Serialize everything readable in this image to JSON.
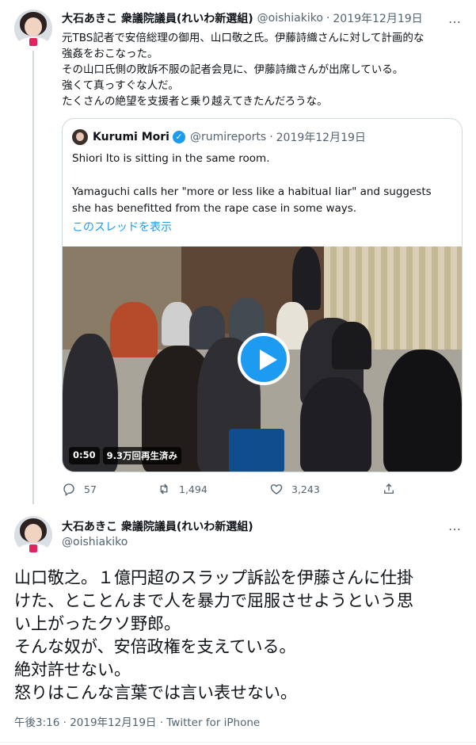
{
  "tweet1": {
    "author_name": "大石あきこ 衆議院議員(れいわ新選組)",
    "handle": "@oishiakiko",
    "separator": "·",
    "date": "2019年12月19日",
    "more_icon": "…",
    "lines": [
      "元TBS記者で安倍総理の御用、山口敬之氏。伊藤詩織さんに対して計画的な",
      "強姦をおこなった。",
      "その山口氏側の敗訴不服の記者会見に、伊藤詩織さんが出席している。",
      "強くて真っすぐな人だ。",
      "たくさんの絶望を支援者と乗り越えてきたんだろうな。"
    ],
    "quote": {
      "author_name": "Kurumi Mori",
      "verified_icon": "✓",
      "handle": "@rumireports",
      "separator": "·",
      "date": "2019年12月19日",
      "line1": "Shiori Ito is sitting in the same room.",
      "line2": "Yamaguchi calls her \"more or less like a habitual liar\" and suggests she has benefitted from the rape case in some ways.",
      "show_thread": "このスレッドを表示",
      "video": {
        "duration": "0:50",
        "views": "9.3万回再生済み"
      }
    },
    "actions": {
      "reply_count": "57",
      "retweet_count": "1,494",
      "like_count": "3,243"
    }
  },
  "tweet2": {
    "author_name": "大石あきこ 衆議院議員(れいわ新選組)",
    "handle": "@oishiakiko",
    "more_icon": "…",
    "lines": [
      "山口敬之。１億円超のスラップ訴訟を伊藤さんに仕掛",
      "けた、とことんまで人を暴力で屈服させようという思",
      "い上がったクソ野郎。",
      "そんな奴が、安倍政権を支えている。",
      "絶対許せない。",
      "怒りはこんな言葉では言い表せない。"
    ],
    "meta": "午後3:16 · 2019年12月19日 · Twitter for iPhone"
  },
  "colors": {
    "accent": "#1d9bf0",
    "muted": "#536471",
    "border": "#cfd9de"
  }
}
